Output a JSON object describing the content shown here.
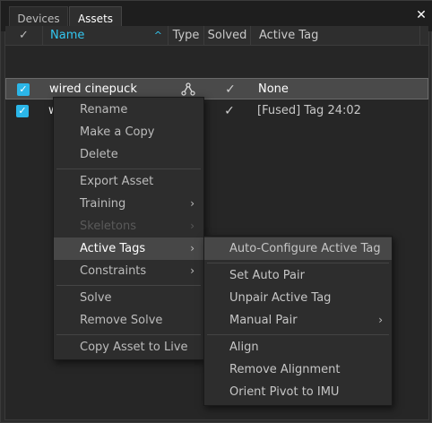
{
  "tabs": [
    {
      "label": "Devices"
    },
    {
      "label": "Assets"
    }
  ],
  "close_glyph": "✕",
  "more_glyph": "•••",
  "table": {
    "headers": {
      "check": "✓",
      "name": "Name",
      "sort_glyph": "^",
      "type": "Type",
      "solved": "Solved",
      "active_tag": "Active Tag"
    },
    "rows": [
      {
        "checked": "✓",
        "name": "wired cinepuck",
        "type_icon": "skeleton-node-icon",
        "solved": "✓",
        "active_tag": "None"
      },
      {
        "checked": "✓",
        "name": "w",
        "type_icon": "",
        "solved": "✓",
        "active_tag": "[Fused] Tag 24:02"
      }
    ]
  },
  "context_menu": {
    "items": [
      {
        "label": "Rename"
      },
      {
        "label": "Make a Copy"
      },
      {
        "label": "Delete"
      },
      {
        "label": "Export Asset"
      },
      {
        "label": "Training",
        "arrow": "›"
      },
      {
        "label": "Skeletons",
        "arrow": "›",
        "disabled": true
      },
      {
        "label": "Active Tags",
        "arrow": "›",
        "highlighted": true
      },
      {
        "label": "Constraints",
        "arrow": "›"
      },
      {
        "label": "Solve"
      },
      {
        "label": "Remove Solve"
      },
      {
        "label": "Copy Asset to Live"
      }
    ]
  },
  "submenu": {
    "items": [
      {
        "label": "Auto-Configure Active Tag",
        "highlighted": true
      },
      {
        "label": "Set Auto Pair"
      },
      {
        "label": "Unpair Active Tag"
      },
      {
        "label": "Manual Pair",
        "arrow": "›"
      },
      {
        "label": "Align"
      },
      {
        "label": "Remove Alignment"
      },
      {
        "label": "Orient Pivot to IMU",
        "disabled": true
      }
    ]
  },
  "colors": {
    "accent": "#2bb6e8",
    "highlight": "#474747",
    "disabled_text": "#5a5a5a"
  }
}
